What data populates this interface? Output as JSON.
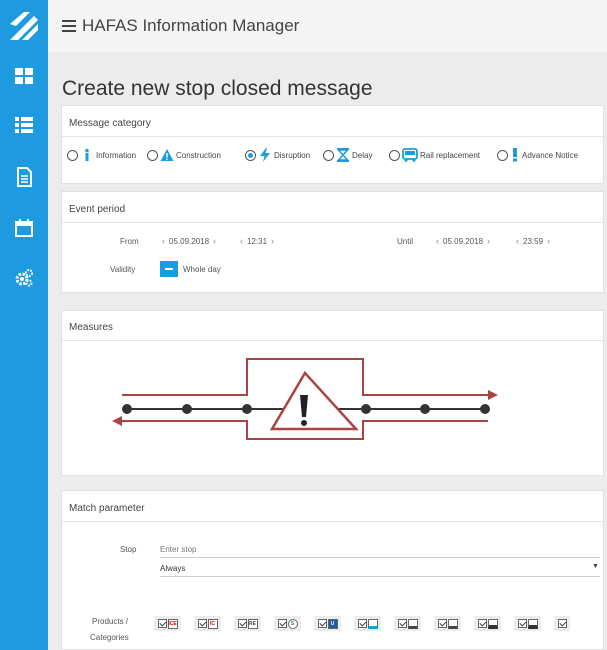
{
  "app": {
    "title": "HAFAS Information Manager"
  },
  "sidebar": {
    "items": [
      {
        "icon": "dashboard-tiles-icon"
      },
      {
        "icon": "list-icon"
      },
      {
        "icon": "document-icon"
      },
      {
        "icon": "calendar-icon"
      },
      {
        "icon": "gears-icon"
      }
    ]
  },
  "page": {
    "title": "Create new stop closed message"
  },
  "category": {
    "title": "Message category",
    "options": [
      {
        "label": "Information",
        "icon": "info-icon",
        "selected": false
      },
      {
        "label": "Construction",
        "icon": "warning-triangle-icon",
        "selected": false
      },
      {
        "label": "Disruption",
        "icon": "lightning-icon",
        "selected": true
      },
      {
        "label": "Delay",
        "icon": "hourglass-icon",
        "selected": false
      },
      {
        "label": "Rail replacement",
        "icon": "bus-icon",
        "selected": false
      },
      {
        "label": "Advance Notice",
        "icon": "exclamation-icon",
        "selected": false
      }
    ]
  },
  "event": {
    "title": "Event period",
    "from_label": "From",
    "from_date": "05.09.2018",
    "from_time": "12:31",
    "until_label": "Until",
    "until_date": "05.09.2018",
    "until_time": "23:59",
    "validity_label": "Validity",
    "whole_day_label": "Whole day"
  },
  "measures": {
    "title": "Measures"
  },
  "match": {
    "title": "Match parameter",
    "stop_label": "Stop",
    "stop_placeholder": "Enter stop",
    "select_value": "Always",
    "products_label_1": "Products /",
    "products_label_2": "Categories",
    "products": [
      {
        "icon": "ice-icon",
        "mark": "ICE"
      },
      {
        "icon": "ic-icon",
        "mark": "IC"
      },
      {
        "icon": "regional-train-icon",
        "mark": "RE"
      },
      {
        "icon": "s-bahn-icon",
        "mark": "S"
      },
      {
        "icon": "u-bahn-icon",
        "mark": "U"
      },
      {
        "icon": "tram-icon",
        "mark": ""
      },
      {
        "icon": "bus-icon",
        "mark": ""
      },
      {
        "icon": "coach-icon",
        "mark": ""
      },
      {
        "icon": "ship-icon",
        "mark": ""
      },
      {
        "icon": "taxi-icon",
        "mark": ""
      },
      {
        "icon": "other-icon",
        "mark": ""
      }
    ]
  },
  "colors": {
    "accent": "#1e9ae0",
    "alert": "#a94442"
  }
}
